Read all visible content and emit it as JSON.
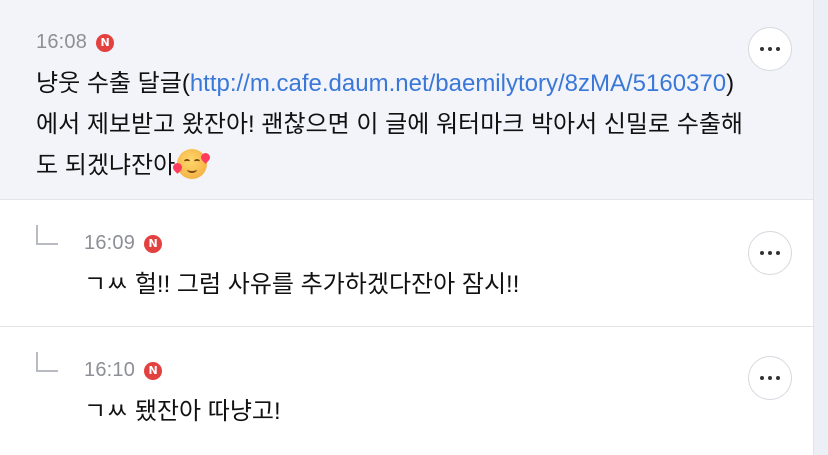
{
  "comments": [
    {
      "time": "16:08",
      "badge": "N",
      "text_before": "냥웃 수출 달글(",
      "link": "http://m.cafe.daum.net/baemilytory/8zMA/5160370",
      "text_after": ") 에서 제보받고 왔잔아! 괜찮으면 이 글에 워터마크 박아서 신밀로 수출해도 되겠냐잔아",
      "emoji": "smiling-face-with-hearts"
    },
    {
      "time": "16:09",
      "badge": "N",
      "text": "ㄱㅆ 헐!! 그럼 사유를 추가하겠다잔아 잠시!!"
    },
    {
      "time": "16:10",
      "badge": "N",
      "text": "ㄱㅆ 됐잔아 따냥고!"
    }
  ],
  "icons": {
    "more": "more-horizontal-icon",
    "reply": "reply-arrow-icon",
    "new": "new-badge-icon"
  },
  "colors": {
    "highlight_bg": "#f2f4fa",
    "link": "#3a78d8",
    "badge": "#e2413f",
    "time": "#8c8f95"
  }
}
